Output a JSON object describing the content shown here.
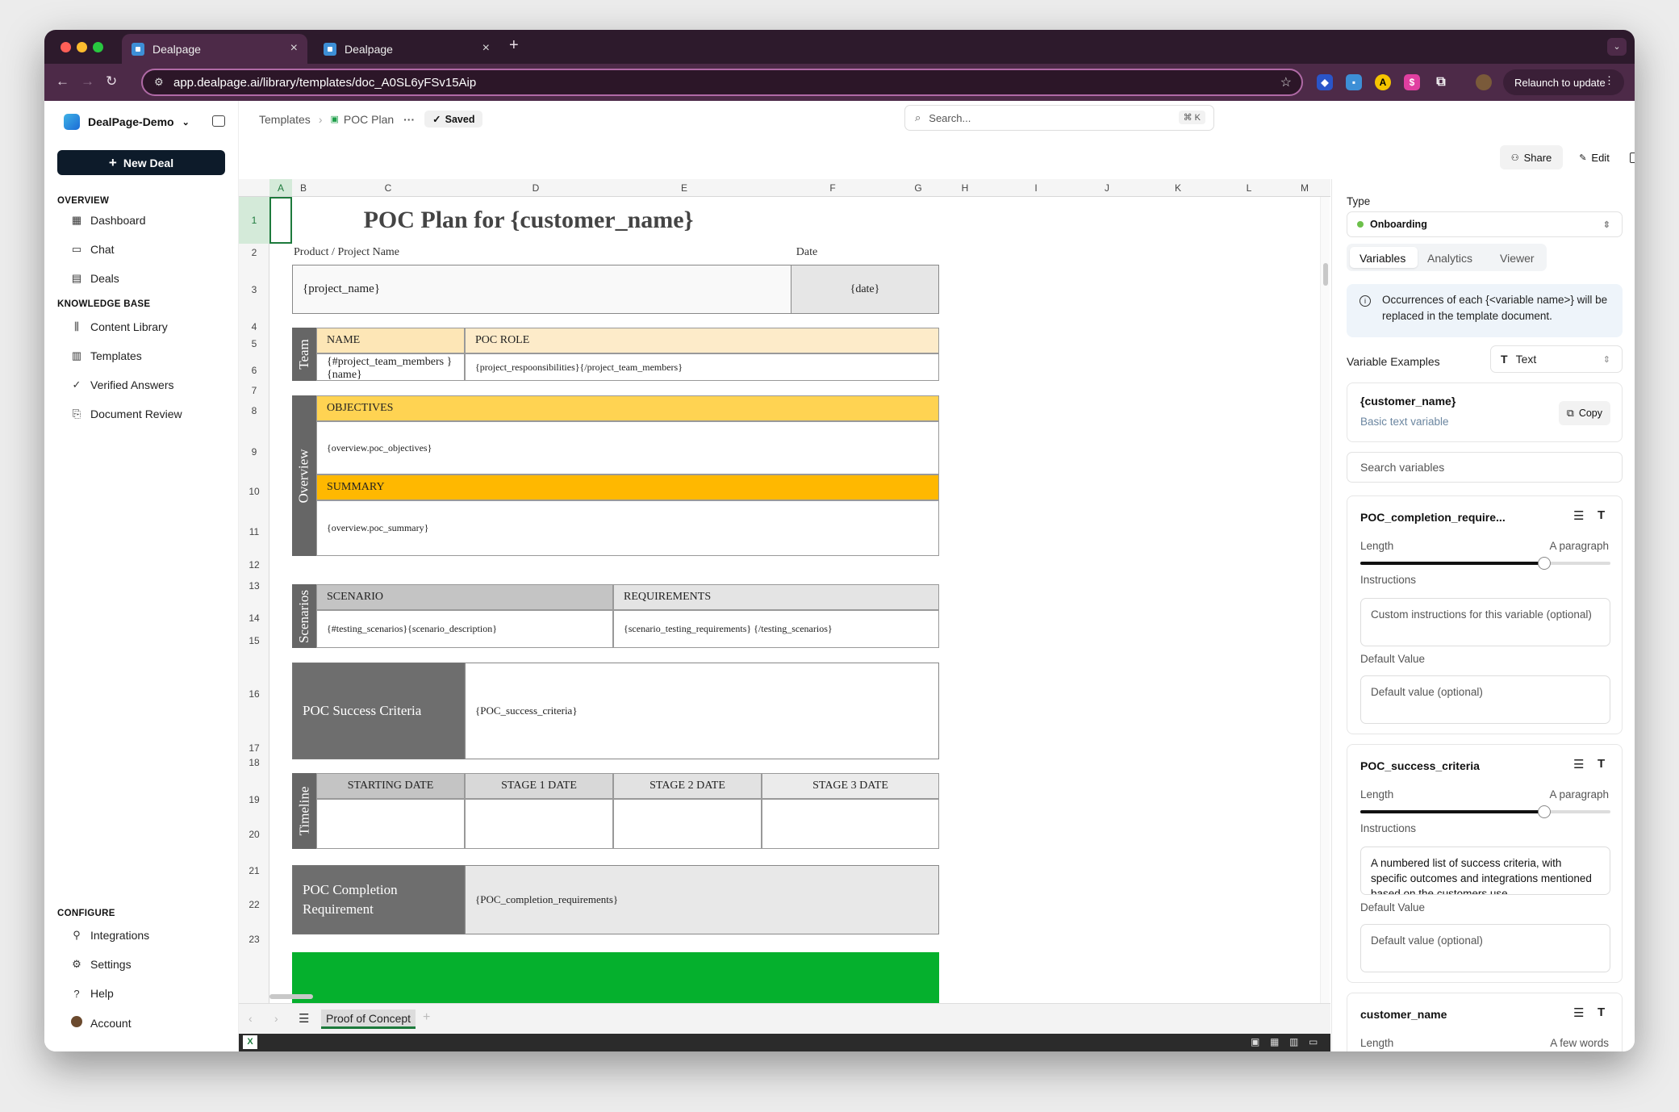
{
  "browser": {
    "tabs": [
      {
        "title": "Dealpage"
      },
      {
        "title": "Dealpage"
      }
    ],
    "url": "app.dealpage.ai/library/templates/doc_A0SL6yFSv15Aip",
    "relaunch_label": "Relaunch to update"
  },
  "sidebar": {
    "workspace": "DealPage-Demo",
    "new_deal": "New Deal",
    "overview_heading": "OVERVIEW",
    "overview_items": [
      {
        "label": "Dashboard"
      },
      {
        "label": "Chat"
      },
      {
        "label": "Deals"
      }
    ],
    "kb_heading": "KNOWLEDGE BASE",
    "kb_items": [
      {
        "label": "Content Library"
      },
      {
        "label": "Templates"
      },
      {
        "label": "Verified Answers"
      },
      {
        "label": "Document Review"
      }
    ],
    "configure_heading": "CONFIGURE",
    "configure_items": [
      {
        "label": "Integrations"
      },
      {
        "label": "Settings"
      },
      {
        "label": "Help"
      },
      {
        "label": "Account"
      }
    ]
  },
  "header": {
    "breadcrumb_root": "Templates",
    "breadcrumb_doc": "POC Plan",
    "saved": "Saved",
    "search_placeholder": "Search...",
    "search_shortcut": "⌘ K",
    "share": "Share",
    "edit": "Edit"
  },
  "sheet": {
    "columns": [
      "A",
      "B",
      "C",
      "D",
      "E",
      "F",
      "G",
      "H",
      "I",
      "J",
      "K",
      "L",
      "M"
    ],
    "rows": [
      "1",
      "2",
      "3",
      "4",
      "5",
      "6",
      "7",
      "8",
      "9",
      "10",
      "11",
      "12",
      "13",
      "14",
      "15",
      "16",
      "17",
      "18",
      "19",
      "20",
      "21",
      "22",
      "23"
    ],
    "title": "POC Plan for {customer_name}",
    "product_label": "Product / Project Name",
    "date_label": "Date",
    "project_name": "{project_name}",
    "date_value": "{date}",
    "team_label": "Team",
    "name_header": "NAME",
    "role_header": "POC ROLE",
    "team_name": "{#project_team_members }{name}",
    "team_role": "{project_respoonsibilities}{/project_team_members}",
    "overview_label": "Overview",
    "objectives_header": "OBJECTIVES",
    "objectives_value": "{overview.poc_objectives}",
    "summary_header": "SUMMARY",
    "summary_value": "{overview.poc_summary}",
    "scenarios_label": "Scenarios",
    "scenario_header": "SCENARIO",
    "requirements_header": "REQUIREMENTS",
    "scenario_value": "{#testing_scenarios}{scenario_description}",
    "requirements_value": "{scenario_testing_requirements} {/testing_scenarios}",
    "success_label": "POC Success Criteria",
    "success_value": "{POC_success_criteria}",
    "timeline_label": "Timeline",
    "timeline_headers": [
      "STARTING DATE",
      "STAGE 1 DATE",
      "STAGE 2 DATE",
      "STAGE 3 DATE"
    ],
    "completion_label": "POC Completion Requirement",
    "completion_value": "{POC_completion_requirements}",
    "sheet_tab": "Proof of Concept",
    "green_color": "#05b02d"
  },
  "panel": {
    "type_label": "Type",
    "type_value": "Onboarding",
    "tabs": [
      "Variables",
      "Analytics",
      "Viewer"
    ],
    "info": "Occurrences of each {<variable name>} will be replaced in the template document.",
    "examples_label": "Variable Examples",
    "examples_type": "Text",
    "example_name": "{customer_name}",
    "example_desc": "Basic text variable",
    "copy_label": "Copy",
    "search_variables": "Search variables",
    "variables": [
      {
        "name": "POC_completion_require...",
        "length_label": "Length",
        "length_value": "A paragraph",
        "length_level": 0.74,
        "instructions_label": "Instructions",
        "instructions_placeholder": "Custom instructions for this variable (optional)",
        "default_label": "Default Value",
        "default_placeholder": "Default value (optional)"
      },
      {
        "name": "POC_success_criteria",
        "length_label": "Length",
        "length_value": "A paragraph",
        "length_level": 0.74,
        "instructions_label": "Instructions",
        "instructions_value": "A numbered list of success criteria, with specific outcomes and integrations mentioned based on the customers use",
        "default_label": "Default Value",
        "default_placeholder": "Default value (optional)"
      },
      {
        "name": "customer_name",
        "length_label": "Length",
        "length_value": "A few words"
      }
    ]
  }
}
